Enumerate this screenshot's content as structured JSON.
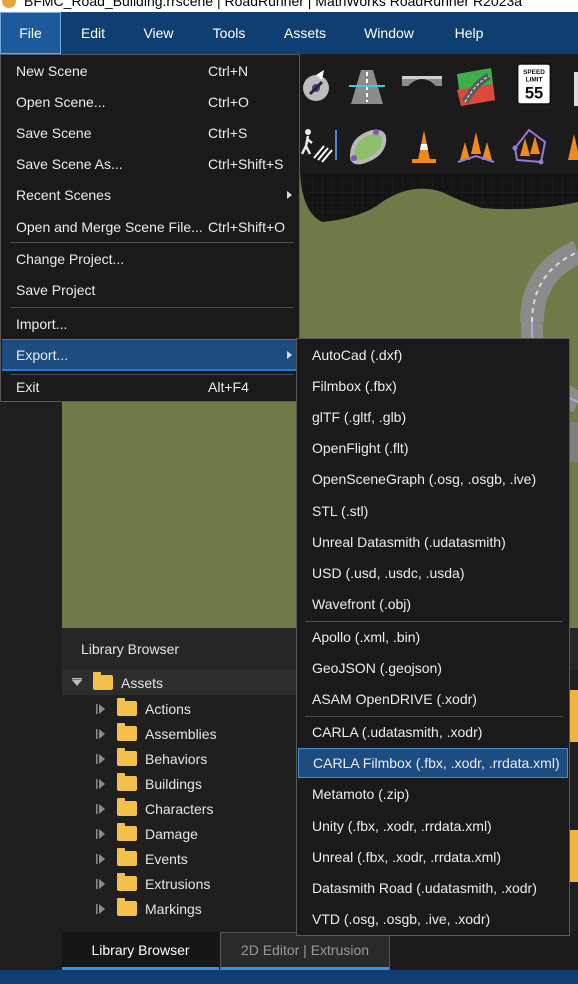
{
  "window": {
    "title": "BFMC_Road_Building.rrscene | RoadRunner | MathWorks RoadRunner R2023a"
  },
  "menubar": {
    "items": [
      {
        "label": "File"
      },
      {
        "label": "Edit"
      },
      {
        "label": "View"
      },
      {
        "label": "Tools"
      },
      {
        "label": "Assets"
      },
      {
        "label": "Window"
      },
      {
        "label": "Help"
      }
    ],
    "active": "File"
  },
  "toolbar": {
    "icons": [
      "lane-tool-icon",
      "road-tool-icon",
      "bridge-tool-icon",
      "road-styles-icon",
      "speed-limit-sign-icon",
      "crosswalk-tool-icon",
      "surface-tool-icon",
      "cone-icon",
      "cone-group-icon",
      "cone-polygon-icon",
      "cone-partial-icon"
    ],
    "speed_sign": {
      "line1": "SPEED",
      "line2": "LIMIT",
      "value": "55"
    }
  },
  "file_menu": {
    "items": [
      {
        "label": "New Scene",
        "shortcut": "Ctrl+N"
      },
      {
        "label": "Open Scene...",
        "shortcut": "Ctrl+O"
      },
      {
        "label": "Save Scene",
        "shortcut": "Ctrl+S"
      },
      {
        "label": "Save Scene As...",
        "shortcut": "Ctrl+Shift+S"
      },
      {
        "label": "Recent Scenes",
        "shortcut": ""
      },
      {
        "label": "Open and Merge Scene File...",
        "shortcut": "Ctrl+Shift+O"
      },
      {
        "label": "Change Project...",
        "shortcut": ""
      },
      {
        "label": "Save Project",
        "shortcut": ""
      },
      {
        "label": "Import...",
        "shortcut": ""
      },
      {
        "label": "Export...",
        "shortcut": ""
      },
      {
        "label": "Exit",
        "shortcut": "Alt+F4"
      }
    ],
    "highlighted": "Export..."
  },
  "export_menu": {
    "items": [
      {
        "label": "AutoCad (.dxf)"
      },
      {
        "label": "Filmbox (.fbx)"
      },
      {
        "label": "glTF (.gltf, .glb)"
      },
      {
        "label": "OpenFlight (.flt)"
      },
      {
        "label": "OpenSceneGraph (.osg, .osgb, .ive)"
      },
      {
        "label": "STL (.stl)"
      },
      {
        "label": "Unreal Datasmith (.udatasmith)"
      },
      {
        "label": "USD (.usd, .usdc, .usda)"
      },
      {
        "label": "Wavefront (.obj)"
      },
      {
        "label": "Apollo (.xml, .bin)"
      },
      {
        "label": "GeoJSON (.geojson)"
      },
      {
        "label": "ASAM OpenDRIVE (.xodr)"
      },
      {
        "label": "CARLA (.udatasmith, .xodr)"
      },
      {
        "label": "CARLA Filmbox (.fbx, .xodr, .rrdata.xml)"
      },
      {
        "label": "Metamoto (.zip)"
      },
      {
        "label": "Unity (.fbx, .xodr, .rrdata.xml)"
      },
      {
        "label": "Unreal (.fbx, .xodr, .rrdata.xml)"
      },
      {
        "label": "Datasmith Road (.udatasmith, .xodr)"
      },
      {
        "label": "VTD (.osg, .osgb, .ive, .xodr)"
      }
    ],
    "highlighted": "CARLA Filmbox (.fbx, .xodr, .rrdata.xml)"
  },
  "library_browser": {
    "title": "Library Browser",
    "root": "Assets",
    "folders": [
      "Actions",
      "Assemblies",
      "Behaviors",
      "Buildings",
      "Characters",
      "Damage",
      "Events",
      "Extrusions",
      "Markings"
    ]
  },
  "bottom_tabs": {
    "tabs": [
      {
        "label": "Library Browser",
        "active": true
      },
      {
        "label": "2D Editor | Extrusion",
        "active": false
      }
    ]
  },
  "colors": {
    "menubar": "#0f3f72",
    "highlight": "#1c4c80",
    "accent": "#3b8fe6",
    "terrain": "#6e7a48",
    "folder": "#f3c14b"
  }
}
